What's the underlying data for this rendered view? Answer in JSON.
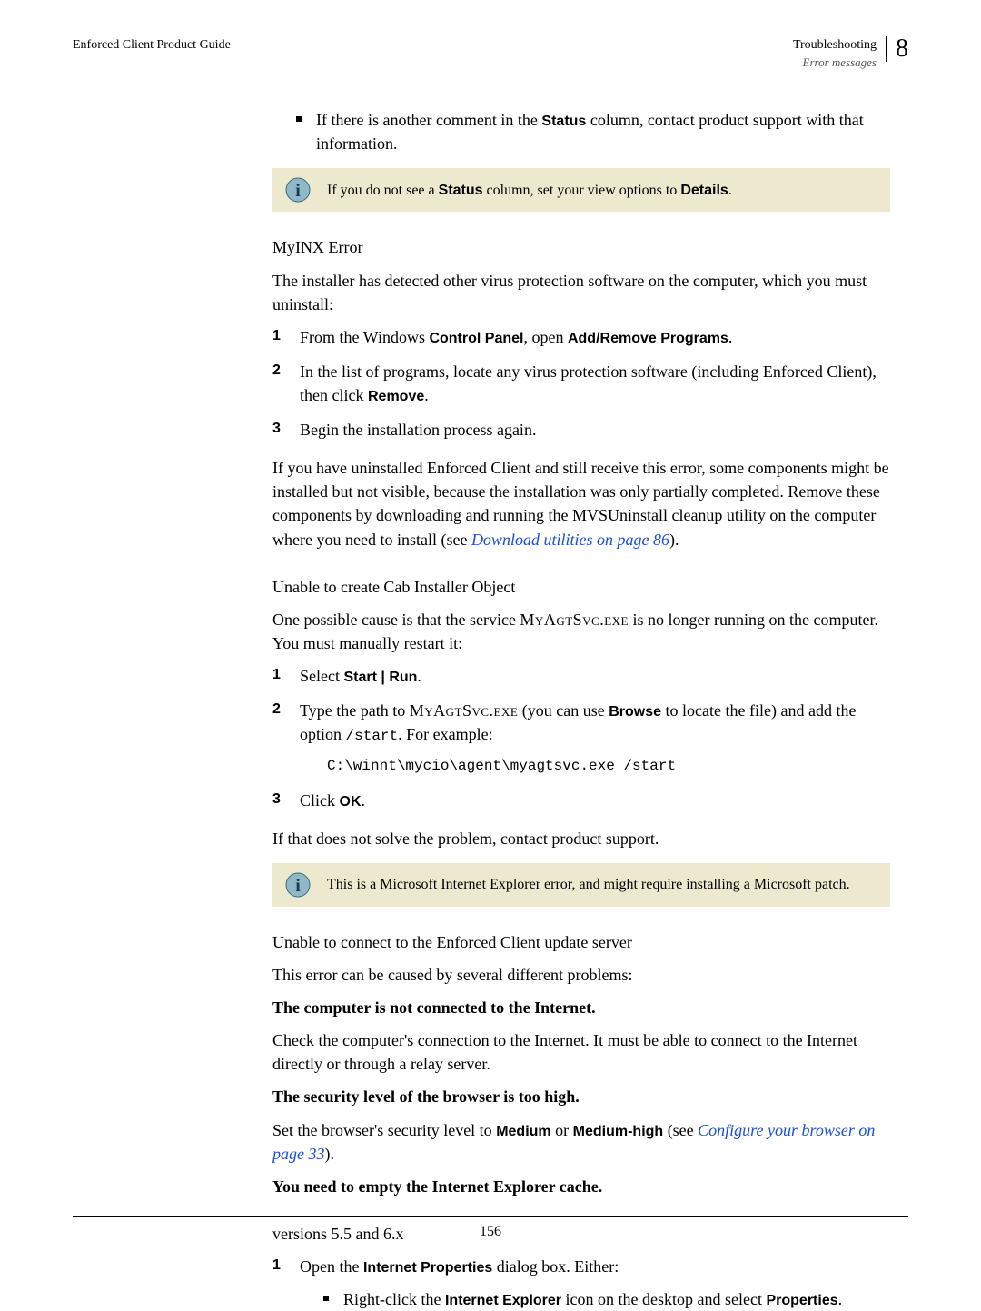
{
  "header": {
    "left": "Enforced Client Product Guide",
    "right_title": "Troubleshooting",
    "right_sub": "Error messages",
    "chapter": "8"
  },
  "intro_bullet_a": "If there is another comment in the ",
  "intro_bullet_b": " column, contact product support with that information.",
  "status_word": "Status",
  "info1_a": "If you do not see a ",
  "info1_b": " column, set your view options to ",
  "info1_details": "Details",
  "info1_c": ".",
  "myinx_head": "MyINX Error",
  "myinx_body": "The installer has detected other virus protection software on the computer, which you must uninstall:",
  "steps1": {
    "s1_a": "From the Windows ",
    "s1_cp": "Control Panel",
    "s1_b": ", open ",
    "s1_arp": "Add/Remove Programs",
    "s1_c": ".",
    "s2_a": "In the list of programs, locate any virus protection software (including Enforced Client), then click ",
    "s2_rm": "Remove",
    "s2_b": ".",
    "s3": "Begin the installation process again."
  },
  "uninstalled_para_a": "If you have uninstalled Enforced Client and still receive this error, some components might be installed but not visible, because the installation was only partially completed. Remove these components by downloading and running the MVSUninstall cleanup utility on the computer where you need to install (see ",
  "uninstalled_link": "Download utilities",
  "uninstalled_para_b": " on page 86",
  "uninstalled_para_c": ").",
  "cab_head": "Unable to create Cab Installer Object",
  "cab_body_a": "One possible cause is that the service ",
  "cab_svc": "MyAgtSvc.exe",
  "cab_body_b": " is no longer running on the computer. You must manually restart it:",
  "steps2": {
    "s1_a": "Select ",
    "s1_start": "Start",
    "s1_pipe": " | ",
    "s1_run": "Run",
    "s1_b": ".",
    "s2_a": "Type the path to ",
    "s2_b": " (you can use ",
    "s2_browse": "Browse",
    "s2_c": " to locate the file) and add the option ",
    "s2_start": "/start",
    "s2_d": ". For example:",
    "code": "C:\\winnt\\mycio\\agent\\myagtsvc.exe /start",
    "s3_a": "Click ",
    "s3_ok": "OK",
    "s3_b": "."
  },
  "after_cab": "If that does not solve the problem, contact product support.",
  "info2": "This is a Microsoft Internet Explorer error, and might require installing a Microsoft patch.",
  "connect_head": "Unable to connect to the Enforced Client update server",
  "connect_body": "This error can be caused by several different problems:",
  "p1_head": "The computer is not connected to the Internet.",
  "p1_body": "Check the computer's connection to the Internet. It must be able to connect to the Internet directly or through a relay server.",
  "p2_head": "The security level of the browser is too high.",
  "p2_a": "Set the browser's security level to ",
  "p2_med": "Medium",
  "p2_or": " or ",
  "p2_medh": "Medium-high",
  "p2_b": " (see ",
  "p2_link": "Configure your browser",
  "p2_c": " on page 33",
  "p2_d": ").",
  "p3_head": "You need to empty the Internet Explorer cache.",
  "versions": "versions 5.5 and 6.x",
  "steps3": {
    "s1_a": "Open the ",
    "s1_ip": "Internet Properties",
    "s1_b": " dialog box. Either:"
  },
  "sub_bullet_a": "Right-click the ",
  "sub_bullet_ie": "Internet Explorer",
  "sub_bullet_b": " icon on the desktop and select ",
  "sub_bullet_props": "Properties",
  "sub_bullet_c": ".",
  "page_num": "156"
}
